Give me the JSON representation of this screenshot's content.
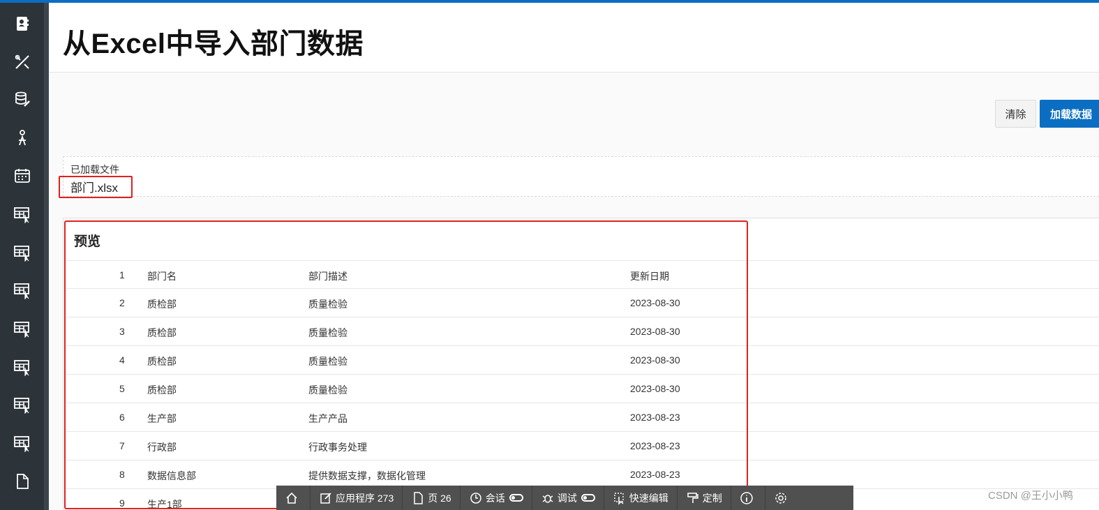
{
  "page": {
    "title": "从Excel中导入部门数据"
  },
  "nav": {
    "items": [
      {
        "name": "contact-card-icon"
      },
      {
        "name": "design-tools-icon"
      },
      {
        "name": "database-wrench-icon"
      },
      {
        "name": "person-icon"
      },
      {
        "name": "calendar-icon"
      },
      {
        "name": "table-select-icon"
      },
      {
        "name": "table-select-icon"
      },
      {
        "name": "table-select-icon"
      },
      {
        "name": "table-select-icon"
      },
      {
        "name": "table-select-icon"
      },
      {
        "name": "table-select-icon"
      },
      {
        "name": "table-select-icon"
      },
      {
        "name": "document-icon"
      }
    ]
  },
  "actions": {
    "clear_label": "清除",
    "load_label": "加载数据"
  },
  "file": {
    "label": "已加载文件",
    "name": "部门.xlsx"
  },
  "preview": {
    "title": "预览",
    "rows": [
      {
        "num": "1",
        "name": "部门名",
        "desc": "部门描述",
        "date": "更新日期"
      },
      {
        "num": "2",
        "name": "质检部",
        "desc": "质量检验",
        "date": "2023-08-30"
      },
      {
        "num": "3",
        "name": "质检部",
        "desc": "质量检验",
        "date": "2023-08-30"
      },
      {
        "num": "4",
        "name": "质检部",
        "desc": "质量检验",
        "date": "2023-08-30"
      },
      {
        "num": "5",
        "name": "质检部",
        "desc": "质量检验",
        "date": "2023-08-30"
      },
      {
        "num": "6",
        "name": "生产部",
        "desc": "生产产品",
        "date": "2023-08-23"
      },
      {
        "num": "7",
        "name": "行政部",
        "desc": "行政事务处理",
        "date": "2023-08-23"
      },
      {
        "num": "8",
        "name": "数据信息部",
        "desc": "提供数据支撑，数据化管理",
        "date": "2023-08-23"
      },
      {
        "num": "9",
        "name": "生产1部",
        "desc": "",
        "date": ""
      }
    ]
  },
  "devbar": {
    "app_label": "应用程序 273",
    "page_label": "页 26",
    "session_label": "会话",
    "debug_label": "调试",
    "quickedit_label": "快速编辑",
    "customize_label": "定制"
  },
  "watermark": "CSDN @王小小鸭",
  "colors": {
    "accent": "#0b6ec2",
    "nav_bg": "#2c3339",
    "highlight": "#e02020",
    "devbar_bg": "#505050"
  }
}
